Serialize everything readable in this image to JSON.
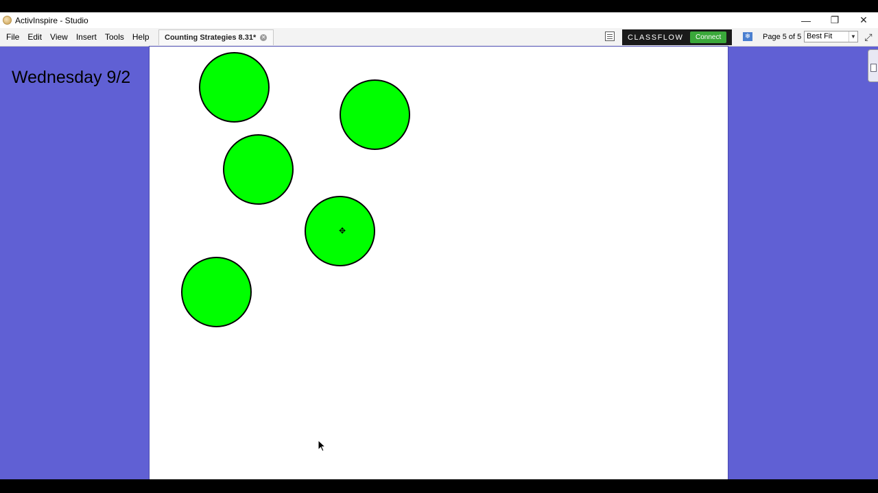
{
  "window": {
    "title": "ActivInspire - Studio"
  },
  "menu": {
    "items": [
      "File",
      "Edit",
      "View",
      "Insert",
      "Tools",
      "Help"
    ]
  },
  "document_tab": {
    "label": "Counting Strategies 8.31*"
  },
  "classflow": {
    "brand": "CLASSFLOW",
    "connect_label": "Connect"
  },
  "page_navigation": {
    "indicator": "Page 5 of 5",
    "zoom": "Best Fit"
  },
  "sidebar": {
    "date_label": "Wednesday 9/2"
  },
  "canvas": {
    "shape_color": "#00ff00",
    "background_color": "#6060d4",
    "shapes": [
      "circle",
      "circle",
      "circle",
      "circle",
      "circle"
    ]
  }
}
